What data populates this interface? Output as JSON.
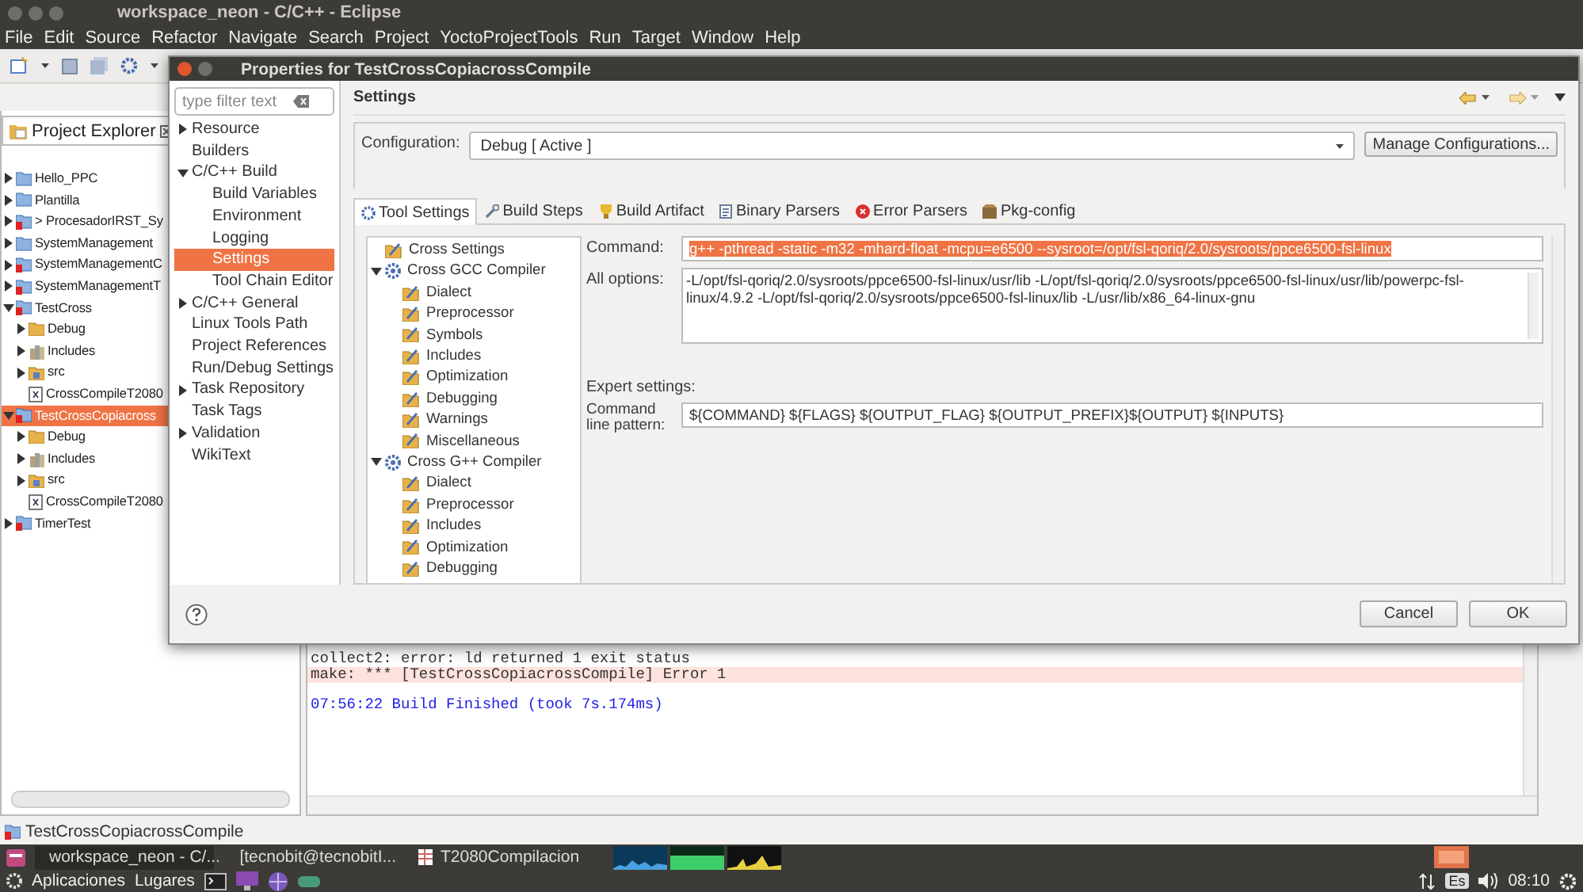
{
  "window": {
    "title": "workspace_neon - C/C++ - Eclipse"
  },
  "menu": [
    "File",
    "Edit",
    "Source",
    "Refactor",
    "Navigate",
    "Search",
    "Project",
    "YoctoProjectTools",
    "Run",
    "Target",
    "Window",
    "Help"
  ],
  "project_explorer": {
    "title": "Project Explorer",
    "items": [
      {
        "label": "Hello_PPC",
        "kind": "project",
        "errors": false,
        "expanded": false,
        "selected": false
      },
      {
        "label": "Plantilla",
        "kind": "project",
        "errors": false,
        "expanded": false,
        "selected": false
      },
      {
        "label": "> ProcesadorIRST_Sy",
        "kind": "project",
        "errors": true,
        "expanded": false,
        "selected": false
      },
      {
        "label": "SystemManagement",
        "kind": "project",
        "errors": false,
        "expanded": false,
        "selected": false
      },
      {
        "label": "SystemManagementC",
        "kind": "project",
        "errors": true,
        "expanded": false,
        "selected": false
      },
      {
        "label": "SystemManagementT",
        "kind": "project",
        "errors": true,
        "expanded": false,
        "selected": false
      },
      {
        "label": "TestCross",
        "kind": "project",
        "errors": true,
        "expanded": true,
        "selected": false,
        "children": [
          {
            "label": "Debug",
            "kind": "folder",
            "expanded": false,
            "selected": false
          },
          {
            "label": "Includes",
            "kind": "includes",
            "expanded": false,
            "selected": false
          },
          {
            "label": "src",
            "kind": "source",
            "expanded": false,
            "selected": false
          },
          {
            "label": "CrossCompileT2080",
            "kind": "file",
            "selected": false
          }
        ]
      },
      {
        "label": "TestCrossCopiacross",
        "kind": "project",
        "errors": true,
        "expanded": true,
        "selected": true,
        "children": [
          {
            "label": "Debug",
            "kind": "folder",
            "expanded": false,
            "selected": false
          },
          {
            "label": "Includes",
            "kind": "includes",
            "expanded": false,
            "selected": false
          },
          {
            "label": "src",
            "kind": "source",
            "expanded": false,
            "selected": false
          },
          {
            "label": "CrossCompileT2080",
            "kind": "file",
            "selected": false
          }
        ]
      },
      {
        "label": "TimerTest",
        "kind": "project",
        "errors": true,
        "expanded": false,
        "selected": false
      }
    ]
  },
  "console": {
    "lines": [
      {
        "kind": "plain",
        "text": "collect2: error: ld returned 1 exit status"
      },
      {
        "kind": "error",
        "text": "make: *** [TestCrossCopiacrossCompile] Error 1"
      },
      {
        "kind": "info",
        "text": "07:56:22 Build Finished (took 7s.174ms)"
      }
    ]
  },
  "status_bar": {
    "text": "TestCrossCopiacrossCompile"
  },
  "dialog": {
    "title": "Properties for TestCrossCopiacrossCompile",
    "filter": {
      "placeholder": "type filter text"
    },
    "nav": [
      {
        "label": "Resource",
        "expanded": false,
        "selected": false
      },
      {
        "label": "Builders",
        "selected": false
      },
      {
        "label": "C/C++ Build",
        "expanded": true,
        "selected": false,
        "children": [
          {
            "label": "Build Variables",
            "selected": false
          },
          {
            "label": "Environment",
            "selected": false
          },
          {
            "label": "Logging",
            "selected": false
          },
          {
            "label": "Settings",
            "selected": true
          },
          {
            "label": "Tool Chain Editor",
            "selected": false
          }
        ]
      },
      {
        "label": "C/C++ General",
        "expanded": false,
        "selected": false
      },
      {
        "label": "Linux Tools Path",
        "selected": false
      },
      {
        "label": "Project References",
        "selected": false
      },
      {
        "label": "Run/Debug Settings",
        "selected": false
      },
      {
        "label": "Task Repository",
        "expanded": false,
        "selected": false
      },
      {
        "label": "Task Tags",
        "selected": false
      },
      {
        "label": "Validation",
        "expanded": false,
        "selected": false
      },
      {
        "label": "WikiText",
        "selected": false
      }
    ],
    "page_title": "Settings",
    "configuration": {
      "label": "Configuration:",
      "value": "Debug  [ Active ]",
      "button": "Manage Configurations..."
    },
    "tabs": [
      {
        "label": "Tool Settings",
        "selected": true
      },
      {
        "label": "Build Steps",
        "selected": false
      },
      {
        "label": "Build Artifact",
        "selected": false
      },
      {
        "label": "Binary Parsers",
        "selected": false
      },
      {
        "label": "Error Parsers",
        "selected": false
      },
      {
        "label": "Pkg-config",
        "selected": false
      }
    ],
    "tools": [
      {
        "label": "Cross Settings",
        "kind": "options",
        "selected": false
      },
      {
        "label": "Cross GCC Compiler",
        "kind": "tool",
        "expanded": true,
        "selected": false,
        "children": [
          {
            "label": "Dialect",
            "kind": "options",
            "selected": false
          },
          {
            "label": "Preprocessor",
            "kind": "options",
            "selected": false
          },
          {
            "label": "Symbols",
            "kind": "options",
            "selected": false
          },
          {
            "label": "Includes",
            "kind": "options",
            "selected": false
          },
          {
            "label": "Optimization",
            "kind": "options",
            "selected": false
          },
          {
            "label": "Debugging",
            "kind": "options",
            "selected": false
          },
          {
            "label": "Warnings",
            "kind": "options",
            "selected": false
          },
          {
            "label": "Miscellaneous",
            "kind": "options",
            "selected": false
          }
        ]
      },
      {
        "label": "Cross G++ Compiler",
        "kind": "tool",
        "expanded": true,
        "selected": false,
        "children": [
          {
            "label": "Dialect",
            "kind": "options",
            "selected": false
          },
          {
            "label": "Preprocessor",
            "kind": "options",
            "selected": false
          },
          {
            "label": "Includes",
            "kind": "options",
            "selected": false
          },
          {
            "label": "Optimization",
            "kind": "options",
            "selected": false
          },
          {
            "label": "Debugging",
            "kind": "options",
            "selected": false
          }
        ]
      }
    ],
    "command": {
      "label": "Command:",
      "value": "g++ -pthread -static -m32 -mhard-float -mcpu=e6500 --sysroot=/opt/fsl-qoriq/2.0/sysroots/ppce6500-fsl-linux",
      "text_selected": true
    },
    "all_options": {
      "label": "All options:",
      "value": "-L/opt/fsl-qoriq/2.0/sysroots/ppce6500-fsl-linux/usr/lib -L/opt/fsl-qoriq/2.0/sysroots/ppce6500-fsl-linux/usr/lib/powerpc-fsl-linux/4.9.2 -L/opt/fsl-qoriq/2.0/sysroots/ppce6500-fsl-linux/lib -L/usr/lib/x86_64-linux-gnu"
    },
    "expert_settings": {
      "title": "Expert settings:",
      "label": "Command line pattern:",
      "value": "${COMMAND} ${FLAGS} ${OUTPUT_FLAG} ${OUTPUT_PREFIX}${OUTPUT} ${INPUTS}"
    },
    "buttons": [
      "Cancel",
      "OK"
    ]
  },
  "taskbar": {
    "tasks": [
      "workspace_neon - C/...",
      "[tecnobit@tecnobitI...",
      "T2080Compilacion"
    ]
  },
  "panel": {
    "menus": [
      "Aplicaciones",
      "Lugares"
    ],
    "keyboard": "Es",
    "clock": "08:10"
  }
}
